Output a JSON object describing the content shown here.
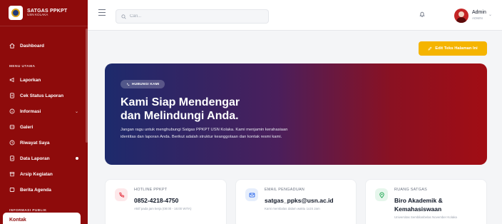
{
  "sidebar": {
    "brand_title": "SATGAS PPKPT",
    "brand_sub": "USN KOLAKA",
    "dashboard": "Dashboard",
    "section_main": "MENU UTAMA",
    "items": [
      {
        "label": "Laporkan",
        "icon": "megaphone-icon"
      },
      {
        "label": "Cek Status Laporan",
        "icon": "document-icon"
      },
      {
        "label": "Informasi",
        "icon": "info-icon"
      },
      {
        "label": "Galeri",
        "icon": "gallery-icon"
      },
      {
        "label": "Riwayat Saya",
        "icon": "history-icon"
      },
      {
        "label": "Data Laporan",
        "icon": "folder-icon"
      },
      {
        "label": "Arsip Kegiatan",
        "icon": "archive-icon"
      },
      {
        "label": "Berita Agenda",
        "icon": "news-icon"
      }
    ],
    "informasi_caret": "⌄",
    "section_public": "INFORMASI PUBLIK",
    "active_item": "Kontak"
  },
  "topbar": {
    "search_placeholder": "Cari...",
    "user_name": "Admin",
    "user_role": "ADMIN"
  },
  "edit_button": "Edit Teks Halaman Ini",
  "hero": {
    "badge": "HUBUNGI KAMI",
    "title_line1": "Kami Siap Mendengar",
    "title_line2": "dan Melindungi Anda.",
    "desc_line1": "Jangan ragu untuk menghubungi Satgas PPKPT USN Kolaka. Kami menjamin kerahasiaan",
    "desc_line2": "identitas dan laporan Anda. Berikut adalah struktur keanggotaan dan kontak resmi kami."
  },
  "cards": [
    {
      "label": "HOTLINE PPKPT",
      "value": "0852-4218-4750",
      "sub": "Aktif pada jam kerja (08:00 - 16:00 WITA)",
      "icon": "phone-icon",
      "color": "#e63946"
    },
    {
      "label": "EMAIL PENGADUAN",
      "value": "satgas_ppks@usn.ac.id",
      "sub": "Kami membalas dalam waktu 1x24 Jam",
      "icon": "mail-icon",
      "color": "#2563eb"
    },
    {
      "label": "RUANG SATGAS",
      "value_line1": "Biro Akademik &",
      "value_line2": "Kemahasiswaan",
      "sub": "Universitas Sembilanbelas November Kolaka",
      "icon": "location-icon",
      "color": "#16a34a"
    }
  ],
  "colors": {
    "sidebar": "#8e0b0b",
    "accent": "#f5b400"
  }
}
